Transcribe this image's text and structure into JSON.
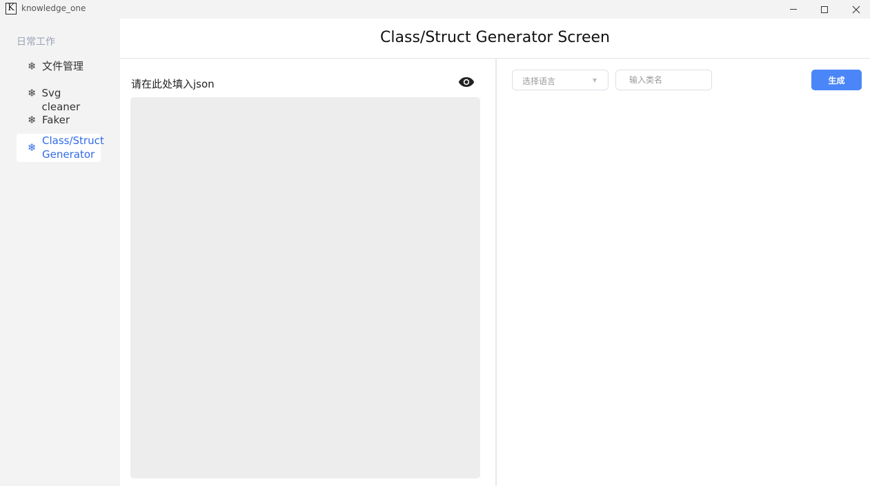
{
  "window": {
    "logo_letter": "K",
    "title": "knowledge_one"
  },
  "sidebar": {
    "section": "日常工作",
    "items": [
      {
        "icon": "❄",
        "label": "文件管理",
        "active": false
      },
      {
        "icon": "❄",
        "label": "Svg cleaner",
        "active": false
      },
      {
        "icon": "❄",
        "label": "Faker",
        "active": false
      },
      {
        "icon": "❄",
        "label": "Class/Struct Generator",
        "active": true
      }
    ]
  },
  "main": {
    "title": "Class/Struct Generator Screen",
    "json_label": "请在此处填入json",
    "json_value": "",
    "language_placeholder": "选择语言",
    "class_name_placeholder": "输入类名",
    "generate_label": "生成"
  },
  "colors": {
    "accent": "#4a86f7",
    "active_nav": "#2f6ae6",
    "editor_bg": "#ededed"
  }
}
